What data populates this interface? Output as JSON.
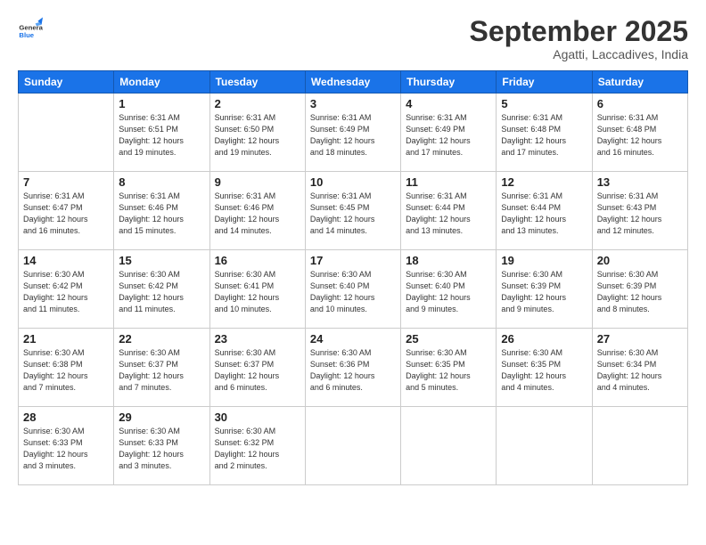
{
  "logo": {
    "line1": "General",
    "line2": "Blue"
  },
  "header": {
    "month": "September 2025",
    "location": "Agatti, Laccadives, India"
  },
  "days_of_week": [
    "Sunday",
    "Monday",
    "Tuesday",
    "Wednesday",
    "Thursday",
    "Friday",
    "Saturday"
  ],
  "weeks": [
    [
      {
        "num": "",
        "info": ""
      },
      {
        "num": "1",
        "info": "Sunrise: 6:31 AM\nSunset: 6:51 PM\nDaylight: 12 hours\nand 19 minutes."
      },
      {
        "num": "2",
        "info": "Sunrise: 6:31 AM\nSunset: 6:50 PM\nDaylight: 12 hours\nand 19 minutes."
      },
      {
        "num": "3",
        "info": "Sunrise: 6:31 AM\nSunset: 6:49 PM\nDaylight: 12 hours\nand 18 minutes."
      },
      {
        "num": "4",
        "info": "Sunrise: 6:31 AM\nSunset: 6:49 PM\nDaylight: 12 hours\nand 17 minutes."
      },
      {
        "num": "5",
        "info": "Sunrise: 6:31 AM\nSunset: 6:48 PM\nDaylight: 12 hours\nand 17 minutes."
      },
      {
        "num": "6",
        "info": "Sunrise: 6:31 AM\nSunset: 6:48 PM\nDaylight: 12 hours\nand 16 minutes."
      }
    ],
    [
      {
        "num": "7",
        "info": "Sunrise: 6:31 AM\nSunset: 6:47 PM\nDaylight: 12 hours\nand 16 minutes."
      },
      {
        "num": "8",
        "info": "Sunrise: 6:31 AM\nSunset: 6:46 PM\nDaylight: 12 hours\nand 15 minutes."
      },
      {
        "num": "9",
        "info": "Sunrise: 6:31 AM\nSunset: 6:46 PM\nDaylight: 12 hours\nand 14 minutes."
      },
      {
        "num": "10",
        "info": "Sunrise: 6:31 AM\nSunset: 6:45 PM\nDaylight: 12 hours\nand 14 minutes."
      },
      {
        "num": "11",
        "info": "Sunrise: 6:31 AM\nSunset: 6:44 PM\nDaylight: 12 hours\nand 13 minutes."
      },
      {
        "num": "12",
        "info": "Sunrise: 6:31 AM\nSunset: 6:44 PM\nDaylight: 12 hours\nand 13 minutes."
      },
      {
        "num": "13",
        "info": "Sunrise: 6:31 AM\nSunset: 6:43 PM\nDaylight: 12 hours\nand 12 minutes."
      }
    ],
    [
      {
        "num": "14",
        "info": "Sunrise: 6:30 AM\nSunset: 6:42 PM\nDaylight: 12 hours\nand 11 minutes."
      },
      {
        "num": "15",
        "info": "Sunrise: 6:30 AM\nSunset: 6:42 PM\nDaylight: 12 hours\nand 11 minutes."
      },
      {
        "num": "16",
        "info": "Sunrise: 6:30 AM\nSunset: 6:41 PM\nDaylight: 12 hours\nand 10 minutes."
      },
      {
        "num": "17",
        "info": "Sunrise: 6:30 AM\nSunset: 6:40 PM\nDaylight: 12 hours\nand 10 minutes."
      },
      {
        "num": "18",
        "info": "Sunrise: 6:30 AM\nSunset: 6:40 PM\nDaylight: 12 hours\nand 9 minutes."
      },
      {
        "num": "19",
        "info": "Sunrise: 6:30 AM\nSunset: 6:39 PM\nDaylight: 12 hours\nand 9 minutes."
      },
      {
        "num": "20",
        "info": "Sunrise: 6:30 AM\nSunset: 6:39 PM\nDaylight: 12 hours\nand 8 minutes."
      }
    ],
    [
      {
        "num": "21",
        "info": "Sunrise: 6:30 AM\nSunset: 6:38 PM\nDaylight: 12 hours\nand 7 minutes."
      },
      {
        "num": "22",
        "info": "Sunrise: 6:30 AM\nSunset: 6:37 PM\nDaylight: 12 hours\nand 7 minutes."
      },
      {
        "num": "23",
        "info": "Sunrise: 6:30 AM\nSunset: 6:37 PM\nDaylight: 12 hours\nand 6 minutes."
      },
      {
        "num": "24",
        "info": "Sunrise: 6:30 AM\nSunset: 6:36 PM\nDaylight: 12 hours\nand 6 minutes."
      },
      {
        "num": "25",
        "info": "Sunrise: 6:30 AM\nSunset: 6:35 PM\nDaylight: 12 hours\nand 5 minutes."
      },
      {
        "num": "26",
        "info": "Sunrise: 6:30 AM\nSunset: 6:35 PM\nDaylight: 12 hours\nand 4 minutes."
      },
      {
        "num": "27",
        "info": "Sunrise: 6:30 AM\nSunset: 6:34 PM\nDaylight: 12 hours\nand 4 minutes."
      }
    ],
    [
      {
        "num": "28",
        "info": "Sunrise: 6:30 AM\nSunset: 6:33 PM\nDaylight: 12 hours\nand 3 minutes."
      },
      {
        "num": "29",
        "info": "Sunrise: 6:30 AM\nSunset: 6:33 PM\nDaylight: 12 hours\nand 3 minutes."
      },
      {
        "num": "30",
        "info": "Sunrise: 6:30 AM\nSunset: 6:32 PM\nDaylight: 12 hours\nand 2 minutes."
      },
      {
        "num": "",
        "info": ""
      },
      {
        "num": "",
        "info": ""
      },
      {
        "num": "",
        "info": ""
      },
      {
        "num": "",
        "info": ""
      }
    ]
  ]
}
